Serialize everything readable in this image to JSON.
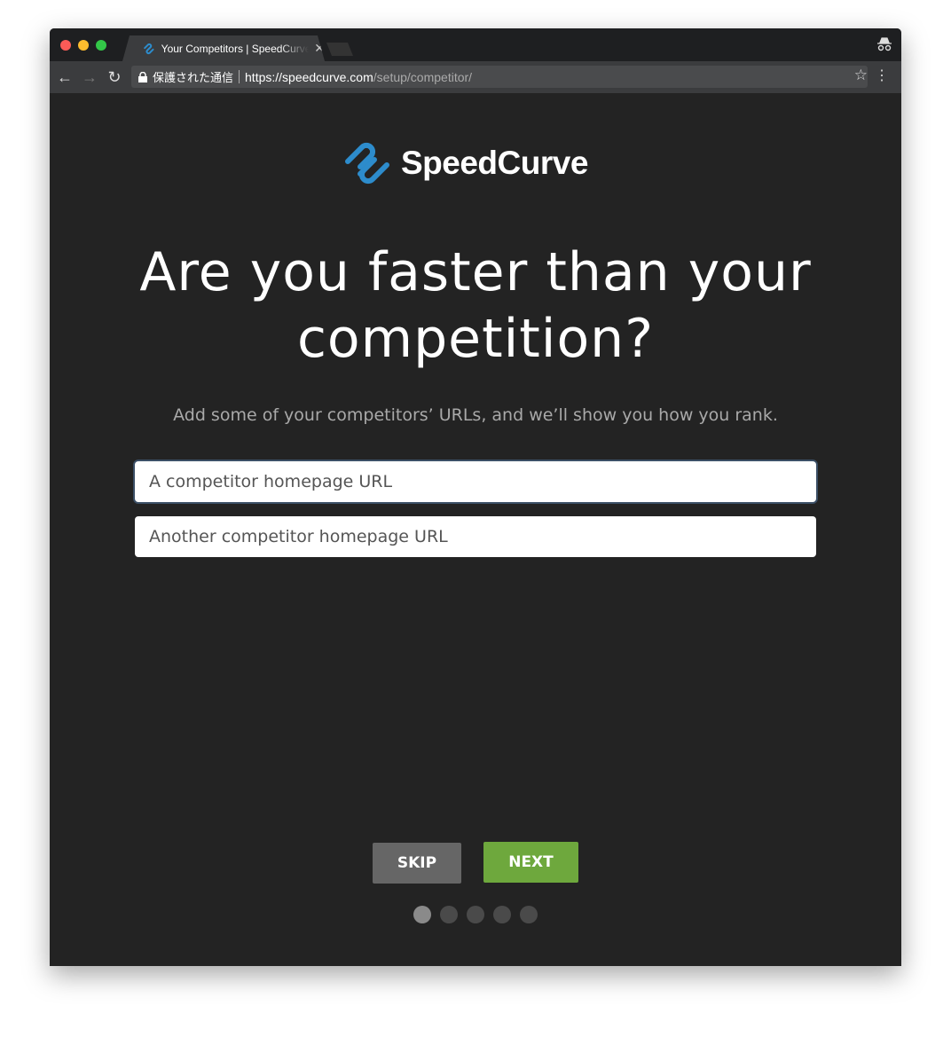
{
  "browser": {
    "tab_title": "Your Competitors | SpeedCurve",
    "security_label": "保護された通信",
    "url_host": "https://speedcurve.com",
    "url_path": "/setup/competitor/"
  },
  "logo": {
    "text": "SpeedCurve",
    "color": "#2d8ccc"
  },
  "page": {
    "heading": "Are you faster than your competition?",
    "subtitle": "Add some of your competitors’ URLs, and we’ll show you how you rank.",
    "input1_placeholder": "A competitor homepage URL",
    "input2_placeholder": "Another competitor homepage URL",
    "skip_label": "SKIP",
    "next_label": "NEXT",
    "next_color": "#6ea83d",
    "progress": {
      "current_step": 1,
      "total_steps": 5
    }
  }
}
